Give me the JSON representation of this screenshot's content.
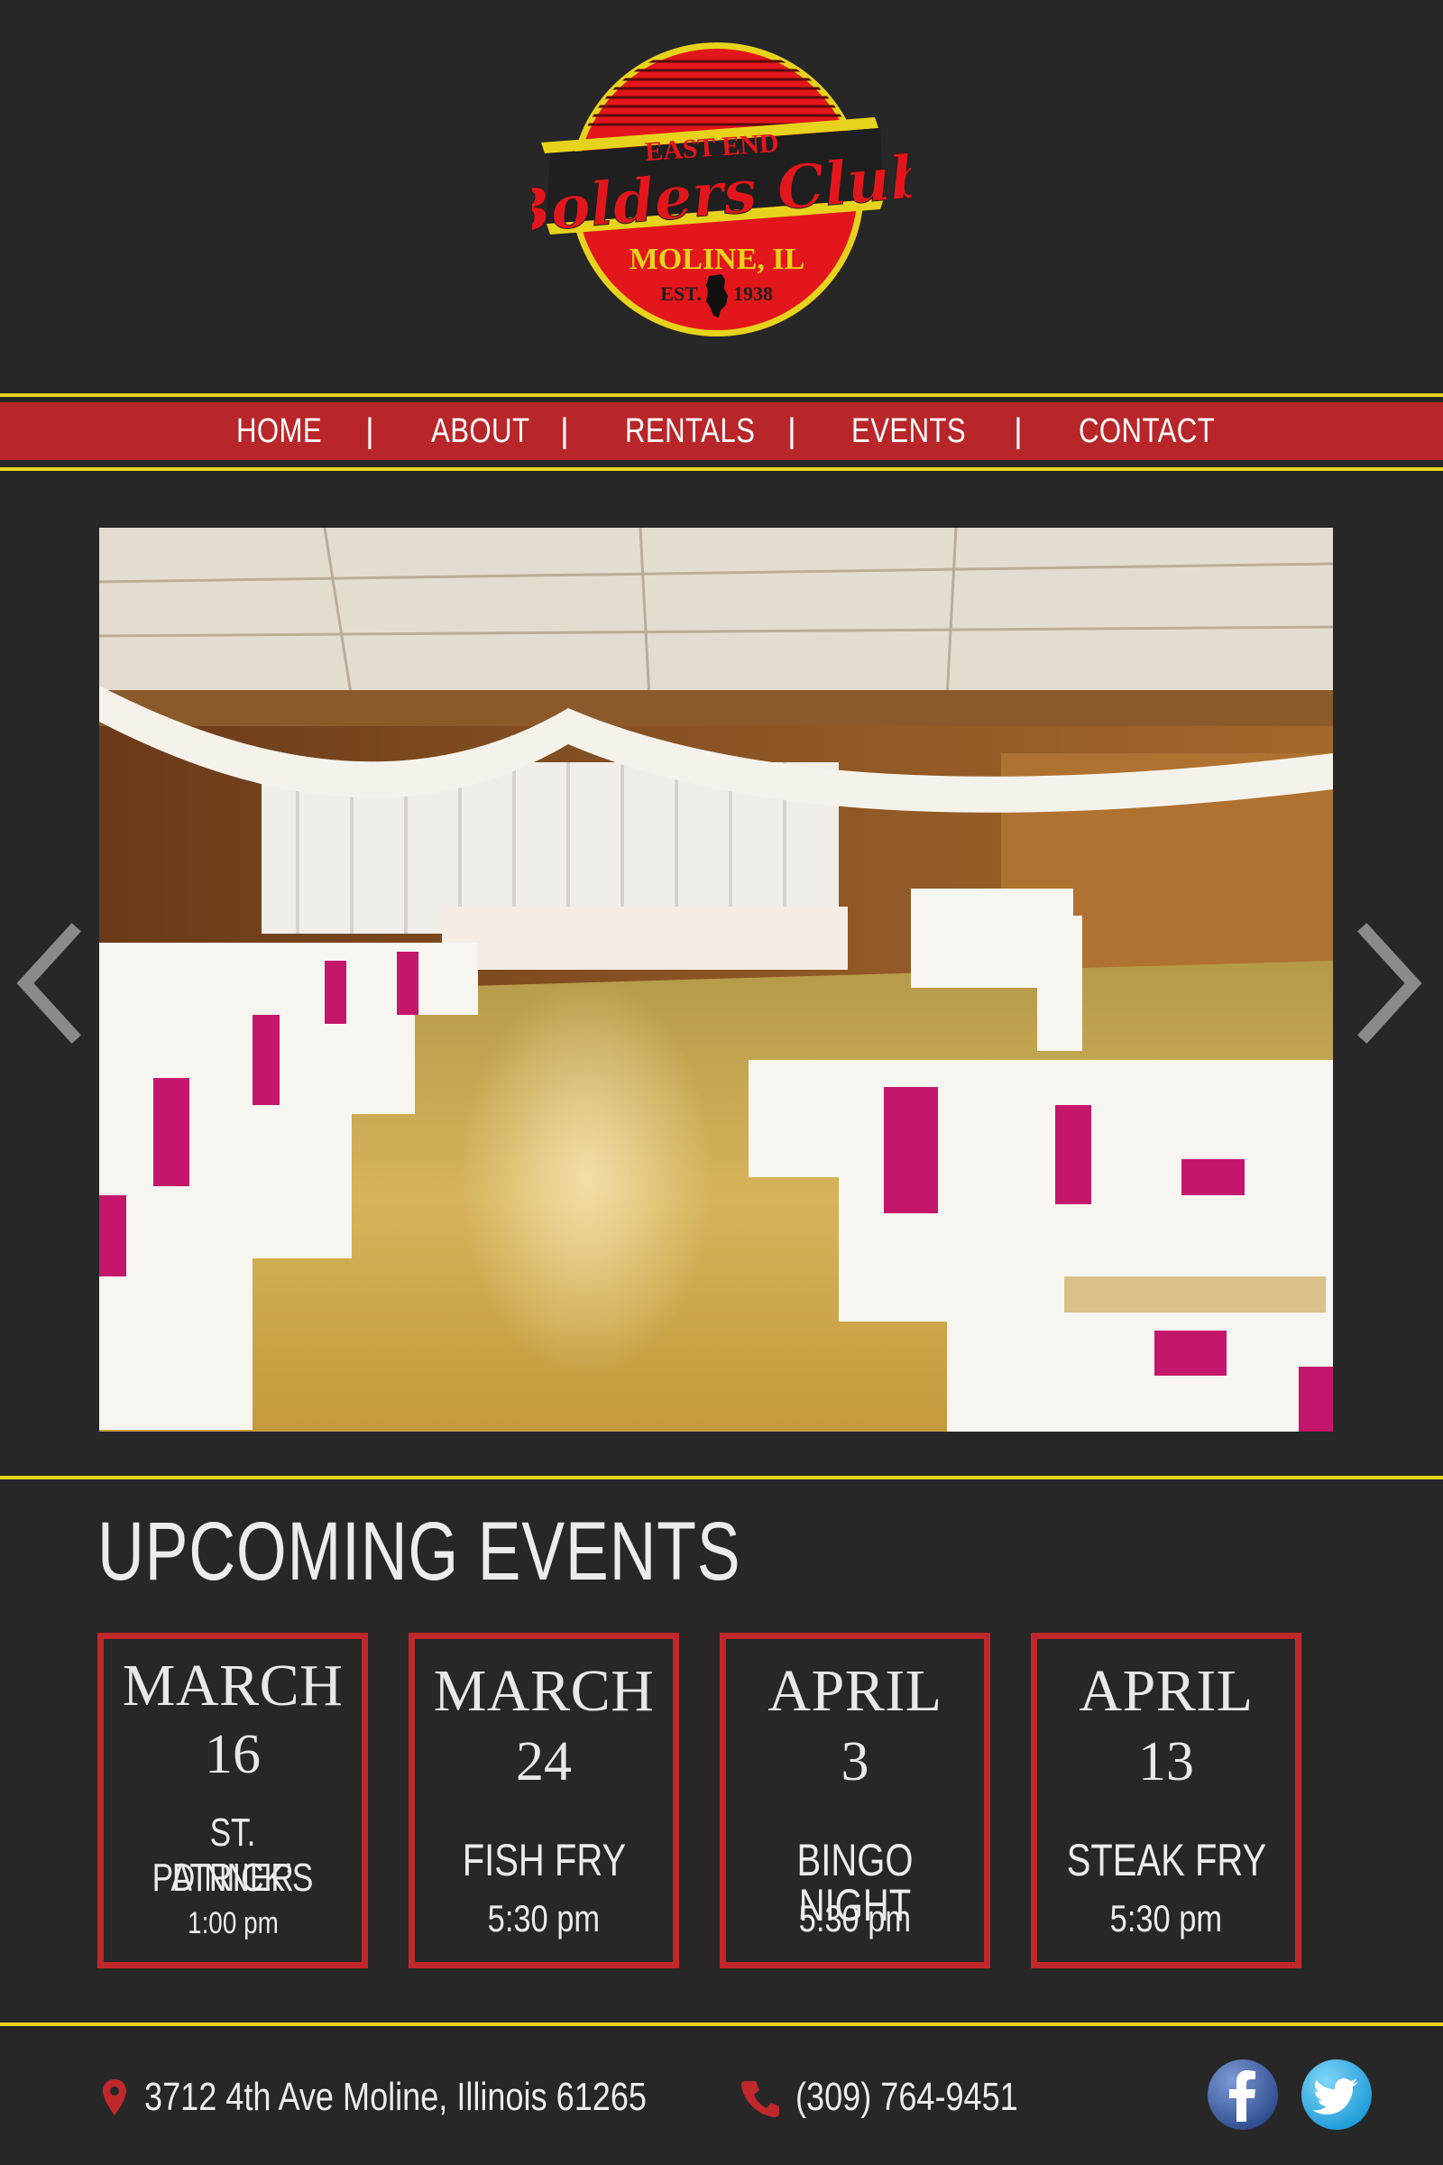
{
  "logo": {
    "line1": "EAST END",
    "line2": "Bolders Club",
    "line3": "MOLINE, IL",
    "est_left": "EST.",
    "est_right": "1938"
  },
  "nav": {
    "items": [
      {
        "label": "HOME"
      },
      {
        "label": "ABOUT"
      },
      {
        "label": "RENTALS"
      },
      {
        "label": "EVENTS"
      },
      {
        "label": "CONTACT"
      }
    ],
    "separator": "|"
  },
  "slider": {
    "prev_icon": "chevron-left-icon",
    "next_icon": "chevron-right-icon",
    "image_subject": "banquet-hall-photo"
  },
  "events": {
    "title": "UPCOMING EVENTS",
    "cards": [
      {
        "month": "MARCH",
        "day": "16",
        "name_line1": "ST. PATRICK’S",
        "name_line2": "DINNER",
        "time": "1:00 pm"
      },
      {
        "month": "MARCH",
        "day": "24",
        "name_line1": "FISH FRY",
        "name_line2": "",
        "time": "5:30 pm"
      },
      {
        "month": "APRIL",
        "day": "3",
        "name_line1": "BINGO NIGHT",
        "name_line2": "",
        "time": "5:30 pm"
      },
      {
        "month": "APRIL",
        "day": "13",
        "name_line1": "STEAK FRY",
        "name_line2": "",
        "time": "5:30 pm"
      }
    ]
  },
  "footer": {
    "address": "3712 4th Ave Moline, Illinois 61265",
    "phone": "(309) 764-9451",
    "icons": [
      "map-pin-icon",
      "phone-icon",
      "facebook-icon",
      "twitter-icon"
    ]
  },
  "colors": {
    "background": "#272727",
    "nav_red": "#b8262a",
    "accent_yellow": "#e8d31c",
    "card_border": "#c0282c"
  }
}
